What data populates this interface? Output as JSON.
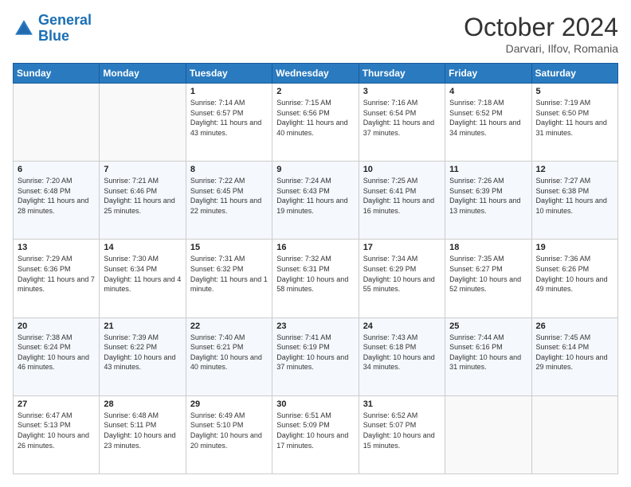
{
  "logo": {
    "line1": "General",
    "line2": "Blue"
  },
  "title": "October 2024",
  "location": "Darvari, Ilfov, Romania",
  "weekdays": [
    "Sunday",
    "Monday",
    "Tuesday",
    "Wednesday",
    "Thursday",
    "Friday",
    "Saturday"
  ],
  "weeks": [
    [
      {
        "day": "",
        "info": ""
      },
      {
        "day": "",
        "info": ""
      },
      {
        "day": "1",
        "info": "Sunrise: 7:14 AM\nSunset: 6:57 PM\nDaylight: 11 hours and 43 minutes."
      },
      {
        "day": "2",
        "info": "Sunrise: 7:15 AM\nSunset: 6:56 PM\nDaylight: 11 hours and 40 minutes."
      },
      {
        "day": "3",
        "info": "Sunrise: 7:16 AM\nSunset: 6:54 PM\nDaylight: 11 hours and 37 minutes."
      },
      {
        "day": "4",
        "info": "Sunrise: 7:18 AM\nSunset: 6:52 PM\nDaylight: 11 hours and 34 minutes."
      },
      {
        "day": "5",
        "info": "Sunrise: 7:19 AM\nSunset: 6:50 PM\nDaylight: 11 hours and 31 minutes."
      }
    ],
    [
      {
        "day": "6",
        "info": "Sunrise: 7:20 AM\nSunset: 6:48 PM\nDaylight: 11 hours and 28 minutes."
      },
      {
        "day": "7",
        "info": "Sunrise: 7:21 AM\nSunset: 6:46 PM\nDaylight: 11 hours and 25 minutes."
      },
      {
        "day": "8",
        "info": "Sunrise: 7:22 AM\nSunset: 6:45 PM\nDaylight: 11 hours and 22 minutes."
      },
      {
        "day": "9",
        "info": "Sunrise: 7:24 AM\nSunset: 6:43 PM\nDaylight: 11 hours and 19 minutes."
      },
      {
        "day": "10",
        "info": "Sunrise: 7:25 AM\nSunset: 6:41 PM\nDaylight: 11 hours and 16 minutes."
      },
      {
        "day": "11",
        "info": "Sunrise: 7:26 AM\nSunset: 6:39 PM\nDaylight: 11 hours and 13 minutes."
      },
      {
        "day": "12",
        "info": "Sunrise: 7:27 AM\nSunset: 6:38 PM\nDaylight: 11 hours and 10 minutes."
      }
    ],
    [
      {
        "day": "13",
        "info": "Sunrise: 7:29 AM\nSunset: 6:36 PM\nDaylight: 11 hours and 7 minutes."
      },
      {
        "day": "14",
        "info": "Sunrise: 7:30 AM\nSunset: 6:34 PM\nDaylight: 11 hours and 4 minutes."
      },
      {
        "day": "15",
        "info": "Sunrise: 7:31 AM\nSunset: 6:32 PM\nDaylight: 11 hours and 1 minute."
      },
      {
        "day": "16",
        "info": "Sunrise: 7:32 AM\nSunset: 6:31 PM\nDaylight: 10 hours and 58 minutes."
      },
      {
        "day": "17",
        "info": "Sunrise: 7:34 AM\nSunset: 6:29 PM\nDaylight: 10 hours and 55 minutes."
      },
      {
        "day": "18",
        "info": "Sunrise: 7:35 AM\nSunset: 6:27 PM\nDaylight: 10 hours and 52 minutes."
      },
      {
        "day": "19",
        "info": "Sunrise: 7:36 AM\nSunset: 6:26 PM\nDaylight: 10 hours and 49 minutes."
      }
    ],
    [
      {
        "day": "20",
        "info": "Sunrise: 7:38 AM\nSunset: 6:24 PM\nDaylight: 10 hours and 46 minutes."
      },
      {
        "day": "21",
        "info": "Sunrise: 7:39 AM\nSunset: 6:22 PM\nDaylight: 10 hours and 43 minutes."
      },
      {
        "day": "22",
        "info": "Sunrise: 7:40 AM\nSunset: 6:21 PM\nDaylight: 10 hours and 40 minutes."
      },
      {
        "day": "23",
        "info": "Sunrise: 7:41 AM\nSunset: 6:19 PM\nDaylight: 10 hours and 37 minutes."
      },
      {
        "day": "24",
        "info": "Sunrise: 7:43 AM\nSunset: 6:18 PM\nDaylight: 10 hours and 34 minutes."
      },
      {
        "day": "25",
        "info": "Sunrise: 7:44 AM\nSunset: 6:16 PM\nDaylight: 10 hours and 31 minutes."
      },
      {
        "day": "26",
        "info": "Sunrise: 7:45 AM\nSunset: 6:14 PM\nDaylight: 10 hours and 29 minutes."
      }
    ],
    [
      {
        "day": "27",
        "info": "Sunrise: 6:47 AM\nSunset: 5:13 PM\nDaylight: 10 hours and 26 minutes."
      },
      {
        "day": "28",
        "info": "Sunrise: 6:48 AM\nSunset: 5:11 PM\nDaylight: 10 hours and 23 minutes."
      },
      {
        "day": "29",
        "info": "Sunrise: 6:49 AM\nSunset: 5:10 PM\nDaylight: 10 hours and 20 minutes."
      },
      {
        "day": "30",
        "info": "Sunrise: 6:51 AM\nSunset: 5:09 PM\nDaylight: 10 hours and 17 minutes."
      },
      {
        "day": "31",
        "info": "Sunrise: 6:52 AM\nSunset: 5:07 PM\nDaylight: 10 hours and 15 minutes."
      },
      {
        "day": "",
        "info": ""
      },
      {
        "day": "",
        "info": ""
      }
    ]
  ]
}
